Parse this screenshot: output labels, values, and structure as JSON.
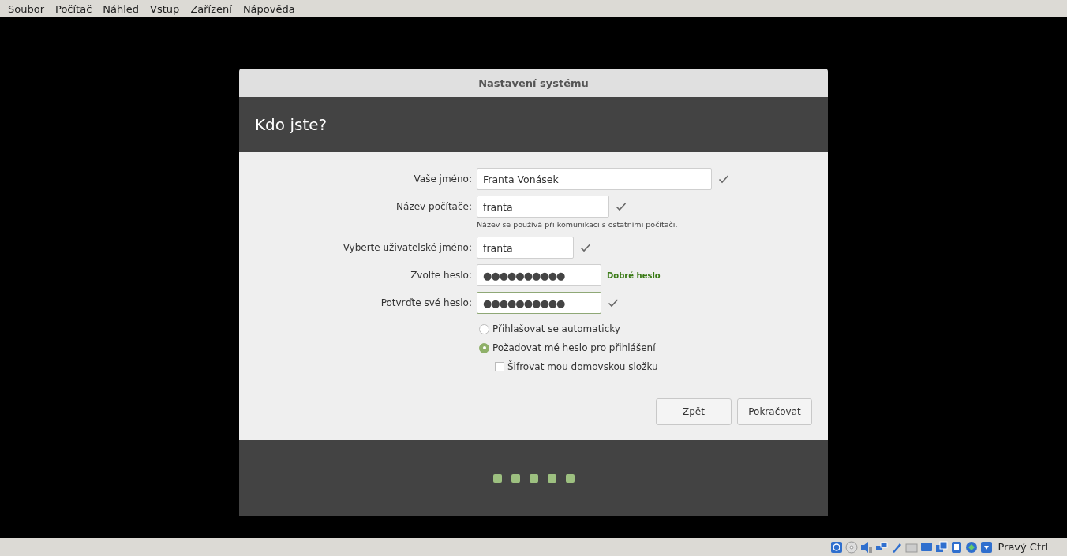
{
  "menu_bar": [
    "Soubor",
    "Počítač",
    "Náhled",
    "Vstup",
    "Zařízení",
    "Nápověda"
  ],
  "dialog": {
    "title": "Nastavení systému",
    "heading": "Kdo jste?",
    "fields": [
      {
        "label": "Vaše jméno:",
        "kind": "text",
        "value": "Franta Vonásek",
        "focused": false,
        "status": {
          "kind": "check"
        }
      },
      {
        "label": "Název počítače:",
        "kind": "text",
        "value": "franta",
        "focused": false,
        "status": {
          "kind": "check"
        },
        "hint": "Název se používá při komunikaci s ostatními počítači."
      },
      {
        "label": "Vyberte uživatelské jméno:",
        "kind": "text",
        "value": "franta",
        "focused": false,
        "status": {
          "kind": "check"
        }
      },
      {
        "label": "Zvolte heslo:",
        "kind": "password",
        "value": "●●●●●●●●●●",
        "focused": false,
        "status": {
          "kind": "strength",
          "text": "Dobré heslo"
        }
      },
      {
        "label": "Potvrďte své heslo:",
        "kind": "password",
        "value": "●●●●●●●●●●",
        "focused": true,
        "status": {
          "kind": "check"
        }
      }
    ],
    "options": [
      {
        "kind": "radio",
        "label": "Přihlašovat se automaticky",
        "selected": false
      },
      {
        "kind": "radio",
        "label": "Požadovat mé heslo pro přihlášení",
        "selected": true
      },
      {
        "kind": "checkbox",
        "label": "Šifrovat mou domovskou složku",
        "checked": false
      }
    ],
    "buttons": [
      "Zpět",
      "Pokračovat"
    ]
  },
  "status_bar": {
    "host_key": "Pravý Ctrl"
  }
}
